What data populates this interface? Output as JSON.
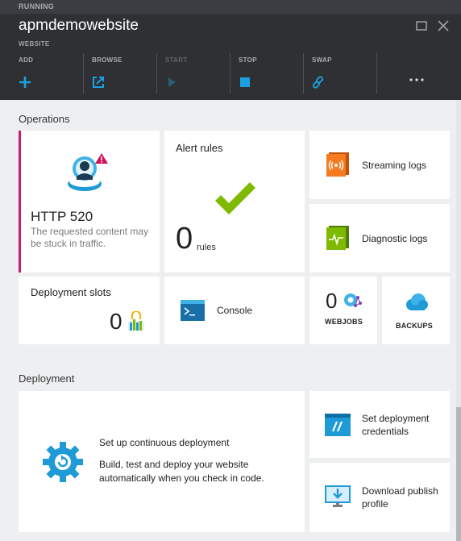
{
  "header": {
    "status": "RUNNING",
    "title": "apmdemowebsite",
    "subtitle": "WEBSITE",
    "commands": [
      {
        "label": "ADD",
        "icon": "plus-icon"
      },
      {
        "label": "BROWSE",
        "icon": "browse-icon"
      },
      {
        "label": "START",
        "icon": "play-icon"
      },
      {
        "label": "STOP",
        "icon": "stop-icon"
      },
      {
        "label": "SWAP",
        "icon": "swap-icon"
      }
    ],
    "more_icon": "ellipsis-icon",
    "accent_color": "#1ba1e2"
  },
  "operations": {
    "section_title": "Operations",
    "http_tile": {
      "title": "HTTP 520",
      "description": "The requested content may be stuck in traffic.",
      "accent_color": "#cf1a74"
    },
    "alert_rules": {
      "title": "Alert rules",
      "count": "0",
      "unit": "rules"
    },
    "streaming_logs": {
      "label": "Streaming logs"
    },
    "diagnostic_logs": {
      "label": "Diagnostic logs"
    },
    "deployment_slots": {
      "title": "Deployment slots",
      "count": "0"
    },
    "console": {
      "label": "Console"
    },
    "webjobs": {
      "count": "0",
      "label": "WEBJOBS"
    },
    "backups": {
      "label": "BACKUPS"
    }
  },
  "deployment": {
    "section_title": "Deployment",
    "continuous": {
      "title": "Set up continuous deployment",
      "description": "Build, test and deploy your website automatically when you check in code."
    },
    "credentials": {
      "label": "Set deployment credentials"
    },
    "publish_profile": {
      "label": "Download publish profile"
    }
  }
}
